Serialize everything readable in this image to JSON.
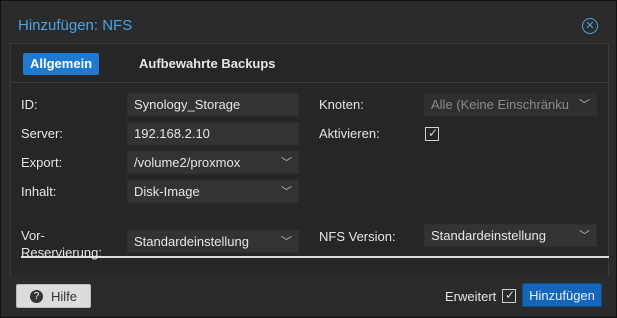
{
  "dialog": {
    "title": "Hinzufügen: NFS",
    "close_icon": "close-circle-icon"
  },
  "tabs": [
    {
      "label": "Allgemein",
      "active": true
    },
    {
      "label": "Aufbewahrte Backups",
      "active": false
    }
  ],
  "form": {
    "id_label": "ID:",
    "id_value": "Synology_Storage",
    "server_label": "Server:",
    "server_value": "192.168.2.10",
    "export_label": "Export:",
    "export_value": "/volume2/proxmox",
    "content_label": "Inhalt:",
    "content_value": "Disk-Image",
    "nodes_label": "Knoten:",
    "nodes_value": "Alle (Keine Einschränku",
    "enable_label": "Aktivieren:",
    "enable_checked": true,
    "prealloc_label_line1": "Vor-",
    "prealloc_label_line2": "Reservierung:",
    "prealloc_value": "Standardeinstellung",
    "nfs_version_label": "NFS Version:",
    "nfs_version_value": "Standardeinstellung"
  },
  "footer": {
    "help_label": "Hilfe",
    "advanced_label": "Erweitert",
    "advanced_checked": true,
    "add_label": "Hinzufügen"
  },
  "colors": {
    "accent": "#1e7ad1",
    "title": "#4fa3e0",
    "background": "#2b2b2b"
  }
}
